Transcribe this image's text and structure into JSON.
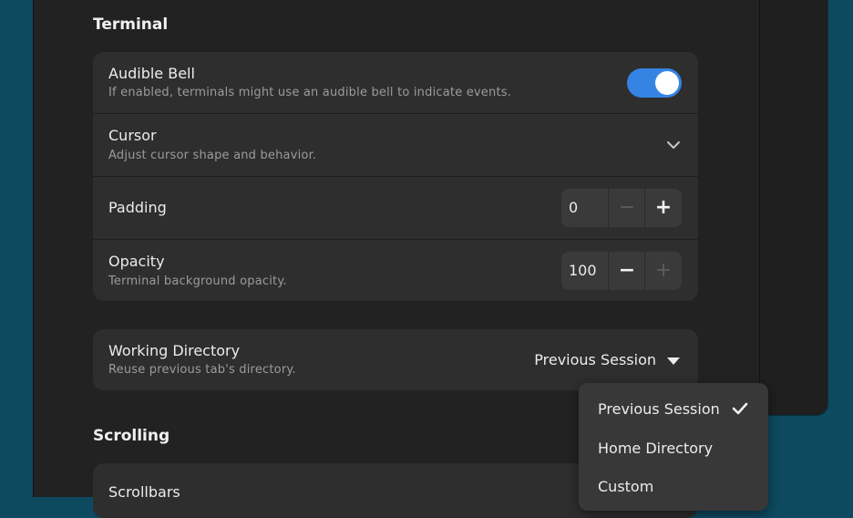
{
  "terminal_section": {
    "title": "Terminal",
    "audible_bell": {
      "title": "Audible Bell",
      "subtitle": "If enabled, terminals might use an audible bell to indicate events.",
      "enabled": true
    },
    "cursor": {
      "title": "Cursor",
      "subtitle": "Adjust cursor shape and behavior.",
      "icon": "chevron-down-icon"
    },
    "padding": {
      "title": "Padding",
      "value": "0",
      "minus_label": "−",
      "plus_label": "+"
    },
    "opacity": {
      "title": "Opacity",
      "subtitle": "Terminal background opacity.",
      "value": "100",
      "minus_label": "−",
      "plus_label": "+"
    }
  },
  "working_directory": {
    "title": "Working Directory",
    "subtitle": "Reuse previous tab's directory.",
    "selected": "Previous Session",
    "icon": "triangle-down-icon"
  },
  "dropdown_menu": {
    "options": [
      "Previous Session",
      "Home Directory",
      "Custom"
    ],
    "checked_index": 0
  },
  "scrolling_section": {
    "title": "Scrolling",
    "scrollbars": {
      "title": "Scrollbars"
    }
  },
  "colors": {
    "accent": "#3584e4",
    "window_bg": "#222222",
    "card_bg": "#2e2e2e",
    "desktop_bg": "#0d4a60"
  }
}
